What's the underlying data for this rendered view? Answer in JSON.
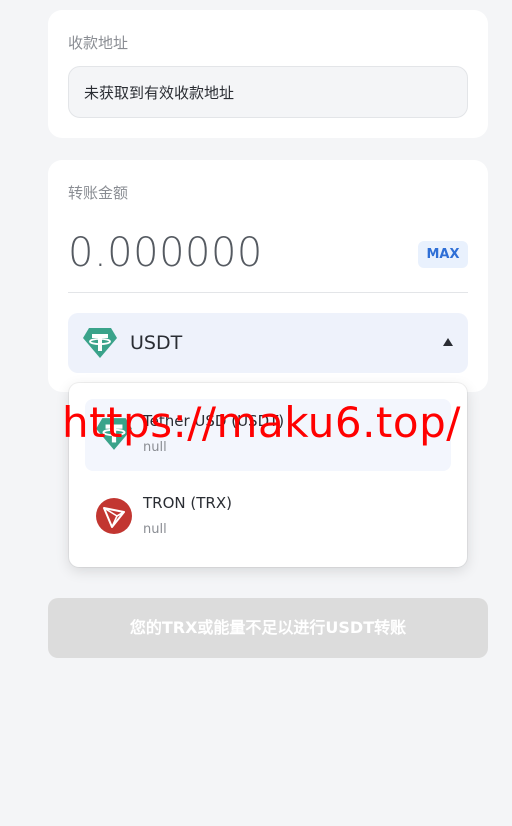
{
  "address_card": {
    "label": "收款地址",
    "value": "未获取到有效收款地址"
  },
  "amount_card": {
    "label": "转账金额",
    "amount": "0.000000",
    "max_label": "MAX",
    "selected_token": "USDT",
    "selected_token_icon": "tether-icon"
  },
  "dropdown": {
    "options": [
      {
        "title": "Tether USD (USDT)",
        "subtitle": "null",
        "icon": "tether-icon"
      },
      {
        "title": "TRON (TRX)",
        "subtitle": "null",
        "icon": "tron-icon"
      }
    ]
  },
  "watermark": "https://maku6.top/",
  "submit_button": "您的TRX或能量不足以进行USDT转账",
  "colors": {
    "accent": "#2f6fd6",
    "tether": "#3aa38a",
    "tron": "#c23631",
    "disabled_button": "#dcdcdc",
    "watermark": "#ff0000"
  }
}
